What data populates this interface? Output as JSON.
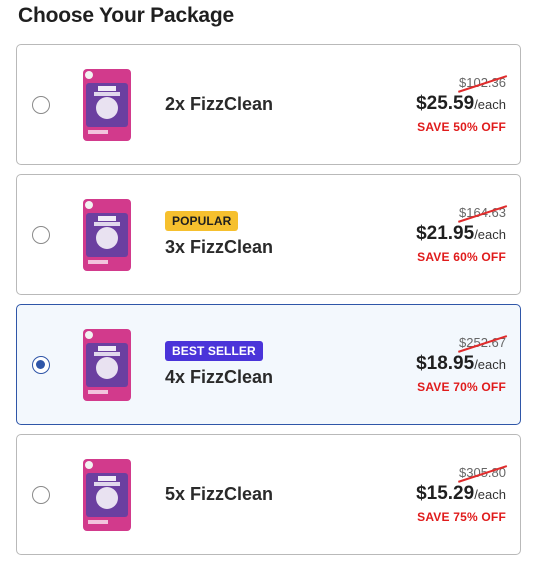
{
  "heading": "Choose Your Package",
  "product_image_text": {
    "line1": "Toilet",
    "line2": "Cleaning Foam",
    "small": "100% active ingredients"
  },
  "packages": [
    {
      "name": "2x FizzClean",
      "badge": "",
      "old_price": "$102.36",
      "price": "$25.59",
      "per": "/each",
      "save": "SAVE 50% OFF",
      "selected": false
    },
    {
      "name": "3x FizzClean",
      "badge": "POPULAR",
      "old_price": "$164.63",
      "price": "$21.95",
      "per": "/each",
      "save": "SAVE 60% OFF",
      "selected": false
    },
    {
      "name": "4x FizzClean",
      "badge": "BEST SELLER",
      "old_price": "$252.67",
      "price": "$18.95",
      "per": "/each",
      "save": "SAVE 70% OFF",
      "selected": true
    },
    {
      "name": "5x FizzClean",
      "badge": "",
      "old_price": "$305.80",
      "price": "$15.29",
      "per": "/each",
      "save": "SAVE 75% OFF",
      "selected": false
    }
  ],
  "colors": {
    "accent_blue": "#2f56a8",
    "popular_badge": "#f6c02e",
    "best_seller_badge": "#4a34d9",
    "save_red": "#e01b1b",
    "pack_magenta": "#d23a8c",
    "pack_purple": "#6b3fa0"
  }
}
